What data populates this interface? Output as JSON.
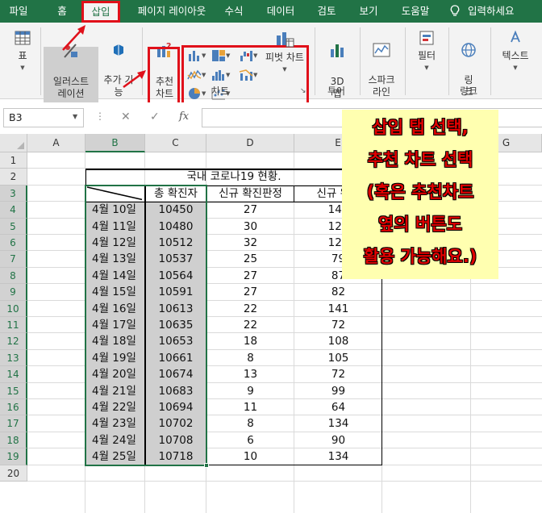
{
  "menu": {
    "items": [
      "파일",
      "홈",
      "삽입",
      "페이지 레이아웃",
      "수식",
      "데이터",
      "검토",
      "보기",
      "도움말"
    ],
    "active": "삽입",
    "search_label": "입력하세요"
  },
  "ribbon": {
    "table_label": "표",
    "illustrations_label": "일러스트\n레이션",
    "addins_label": "추가 기\n능",
    "recommended_label": "추천\n차트",
    "charts_group_label": "차트",
    "pivot_chart_label": "피벗 차트",
    "map3d_label": "3D\n맵",
    "tours_group_label": "투어",
    "sparklines_label": "스파크\n라인",
    "filter_label": "필터",
    "link_label": "링\n크",
    "links_group_label": "링크",
    "text_label": "텍스트"
  },
  "formula_bar": {
    "name_box": "B3",
    "fx": "fx",
    "formula": ""
  },
  "sheet": {
    "columns": [
      "A",
      "B",
      "C",
      "D",
      "E",
      "F",
      "G",
      "H"
    ],
    "selected_column": "B",
    "rows": [
      "1",
      "2",
      "3",
      "4",
      "5",
      "6",
      "7",
      "8",
      "9",
      "10",
      "11",
      "12",
      "13",
      "14",
      "15",
      "16",
      "17",
      "18",
      "19",
      "20"
    ],
    "table_title": "국내 코로나19 현황.",
    "headers": [
      "",
      "총 확진자",
      "신규 확진판정",
      "신규 완치"
    ],
    "data": [
      [
        "4월 10일",
        "10450",
        "27",
        "144"
      ],
      [
        "4월 11일",
        "10480",
        "30",
        "126"
      ],
      [
        "4월 12일",
        "10512",
        "32",
        "125"
      ],
      [
        "4월 13일",
        "10537",
        "25",
        "79"
      ],
      [
        "4월 14일",
        "10564",
        "27",
        "87"
      ],
      [
        "4월 15일",
        "10591",
        "27",
        "82"
      ],
      [
        "4월 16일",
        "10613",
        "22",
        "141"
      ],
      [
        "4월 17일",
        "10635",
        "22",
        "72"
      ],
      [
        "4월 18일",
        "10653",
        "18",
        "108"
      ],
      [
        "4월 19일",
        "10661",
        "8",
        "105"
      ],
      [
        "4월 20일",
        "10674",
        "13",
        "72"
      ],
      [
        "4월 21일",
        "10683",
        "9",
        "99"
      ],
      [
        "4월 22일",
        "10694",
        "11",
        "64"
      ],
      [
        "4월 23일",
        "10702",
        "8",
        "134"
      ],
      [
        "4월 24일",
        "10708",
        "6",
        "90"
      ],
      [
        "4월 25일",
        "10718",
        "10",
        "134"
      ]
    ]
  },
  "callout": {
    "lines": [
      "삽입 탭 선택,",
      "추천 차트 선택",
      "(혹은 추천차트",
      "옆의 버튼도",
      "활용 가능해요.)"
    ]
  },
  "colors": {
    "excel_green": "#217346",
    "annotation_red": "#e0101a",
    "callout_bg": "#ffffb0"
  }
}
